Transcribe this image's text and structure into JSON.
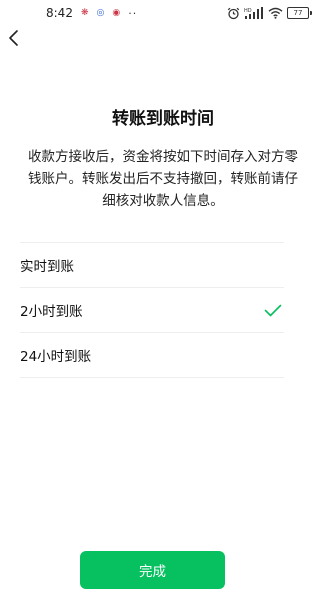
{
  "status_bar": {
    "time": "8:42",
    "notif_more": "··",
    "network_type": "HD",
    "battery_level": "77"
  },
  "page": {
    "title": "转账到账时间",
    "description": "收款方接收后，资金将按如下时间存入对方零钱账户。转账发出后不支持撤回，转账前请仔细核对收款人信息。"
  },
  "options": [
    {
      "label": "实时到账",
      "selected": false
    },
    {
      "label": "2小时到账",
      "selected": true
    },
    {
      "label": "24小时到账",
      "selected": false
    }
  ],
  "footer": {
    "done_label": "完成"
  },
  "colors": {
    "accent": "#07c160",
    "check": "#07c160"
  },
  "icons": {
    "back": "chevron-left-icon",
    "check": "check-icon",
    "alarm": "alarm-icon",
    "signal": "cellular-signal-icon",
    "wifi": "wifi-icon",
    "battery": "battery-icon"
  }
}
